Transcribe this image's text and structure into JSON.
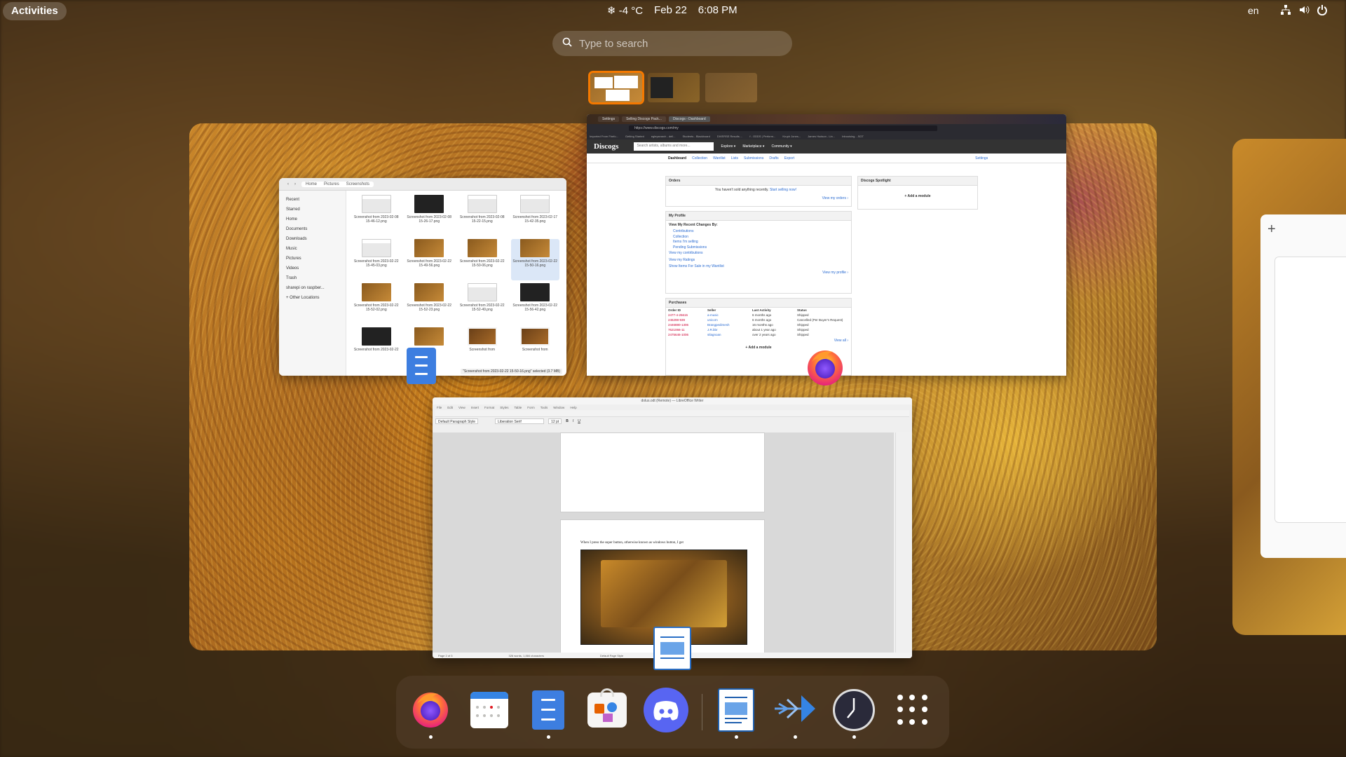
{
  "top_bar": {
    "activities": "Activities",
    "weather": "-4 °C",
    "weather_icon": "snowflake-icon",
    "date": "Feb 22",
    "time": "6:08 PM",
    "language": "en",
    "tray_icons": [
      "network-icon",
      "volume-icon",
      "power-icon"
    ]
  },
  "search": {
    "placeholder": "Type to search"
  },
  "workspaces": {
    "count": 3,
    "active_index": 0
  },
  "files_window": {
    "breadcrumb": [
      "Home",
      "Pictures",
      "Screenshots"
    ],
    "sidebar": [
      "Recent",
      "Starred",
      "Home",
      "Documents",
      "Downloads",
      "Music",
      "Pictures",
      "Videos",
      "Trash",
      "sharepi on raspber...",
      "+ Other Locations"
    ],
    "files": [
      "Screenshot from 2023-02-08 15-46-12.png",
      "Screenshot from 2023-02-08 15-26-17.png",
      "Screenshot from 2023-02-08 15-22-15.png",
      "Screenshot from 2023-02-17 15-42-35.png",
      "Screenshot from 2023-02-22 15-45-03.png",
      "Screenshot from 2023-02-22 15-49-56.png",
      "Screenshot from 2023-02-22 15-50-06.png",
      "Screenshot from 2023-02-22 15-50-16.png",
      "Screenshot from 2023-02-22 15-52-02.png",
      "Screenshot from 2023-02-22 15-52-23.png",
      "Screenshot from 2023-02-22 15-52-49.png",
      "Screenshot from 2023-02-22 15-56-42.png",
      "Screenshot from 2023-02-22",
      "",
      "Screenshot from",
      "Screenshot from"
    ],
    "status": "\"Screenshot from 2023-02-22 15-50-16.png\" selected (3.7 MB)"
  },
  "firefox_window": {
    "tabs": [
      "Settings",
      "Selling Discogs Pack...",
      "Discogs - Dashboard"
    ],
    "url": "https://www.discogs.com/my",
    "bookmarks": [
      "Imported From Firefo...",
      "Getting Started",
      "egleysearch - dell...",
      "Students - Blackboard",
      "DIVERSE Results ...",
      "f - ODDS | Perform...",
      "Kruph Jones...",
      "James Hudson - Lin...",
      "Inbouising ...SGT"
    ],
    "logo": "Discogs",
    "search_placeholder": "Search artists, albums and more...",
    "nav": [
      "Explore ▾",
      "Marketplace ▾",
      "Community ▾"
    ],
    "subnav": [
      "Dashboard",
      "Collection",
      "Wantlist",
      "Lists",
      "Submissions",
      "Drafts",
      "Export"
    ],
    "settings_link": "Settings",
    "orders": {
      "title": "Orders",
      "text": "You haven't sold anything recently.",
      "link": "Start selling now!",
      "view": "View my orders ›"
    },
    "spotlight": {
      "title": "Discogs Spotlight",
      "add": "+ Add a module"
    },
    "profile": {
      "title": "My Profile",
      "subtitle": "View My Recent Changes By:",
      "items": [
        "Contributions",
        "Collection",
        "Items I'm selling",
        "Pending Submissions"
      ],
      "links": [
        "View my contributions",
        "View my Ratings",
        "Show Items For Sale in my Wantlist"
      ],
      "view": "View my profile ›"
    },
    "purchases": {
      "title": "Purchases",
      "headers": [
        "Order ID",
        "Seller",
        "Last Activity",
        "Status"
      ],
      "rows": [
        [
          "2477-4-25615",
          "a-music",
          "6 months ago",
          "Shipped"
        ],
        [
          "246298-939",
          "unicorn",
          "6 months ago",
          "Cancelled (Per Buyer's Request)"
        ],
        [
          "2446880-1306",
          "Brangpedimesh",
          "16 months ago",
          "Shipped"
        ],
        [
          "7621066-11",
          "J.R.bbr",
          "about 1 year ago",
          "Shipped"
        ],
        [
          "2475646-1006",
          "stlagnoan",
          "over 2 years ago",
          "Shipped"
        ]
      ],
      "view": "View all ›",
      "add": "+ Add a module"
    }
  },
  "writer_window": {
    "title": "dolus.odt (Remote) — LibreOffice Writer",
    "menu": [
      "File",
      "Edit",
      "View",
      "Insert",
      "Format",
      "Styles",
      "Table",
      "Form",
      "Tools",
      "Window",
      "Help"
    ],
    "paragraph_style": "Default Paragraph Style",
    "font_name": "Liberation Serif",
    "font_size": "12 pt",
    "body_text": "When I press the super button, otherwise known as windows button, I get",
    "status": [
      "Page 2 of 3",
      "326 words, 1,884 characters",
      "Default Page Style",
      "100%"
    ]
  },
  "dash": {
    "items": [
      {
        "name": "firefox-icon",
        "running": true
      },
      {
        "name": "calendar-icon",
        "running": false
      },
      {
        "name": "files-icon",
        "running": true
      },
      {
        "name": "software-icon",
        "running": false
      },
      {
        "name": "discord-icon",
        "running": false
      },
      {
        "name": "writer-icon",
        "running": true
      },
      {
        "name": "audio-app-icon",
        "running": true
      },
      {
        "name": "clock-icon",
        "running": true
      },
      {
        "name": "app-grid-icon",
        "running": false
      }
    ]
  }
}
